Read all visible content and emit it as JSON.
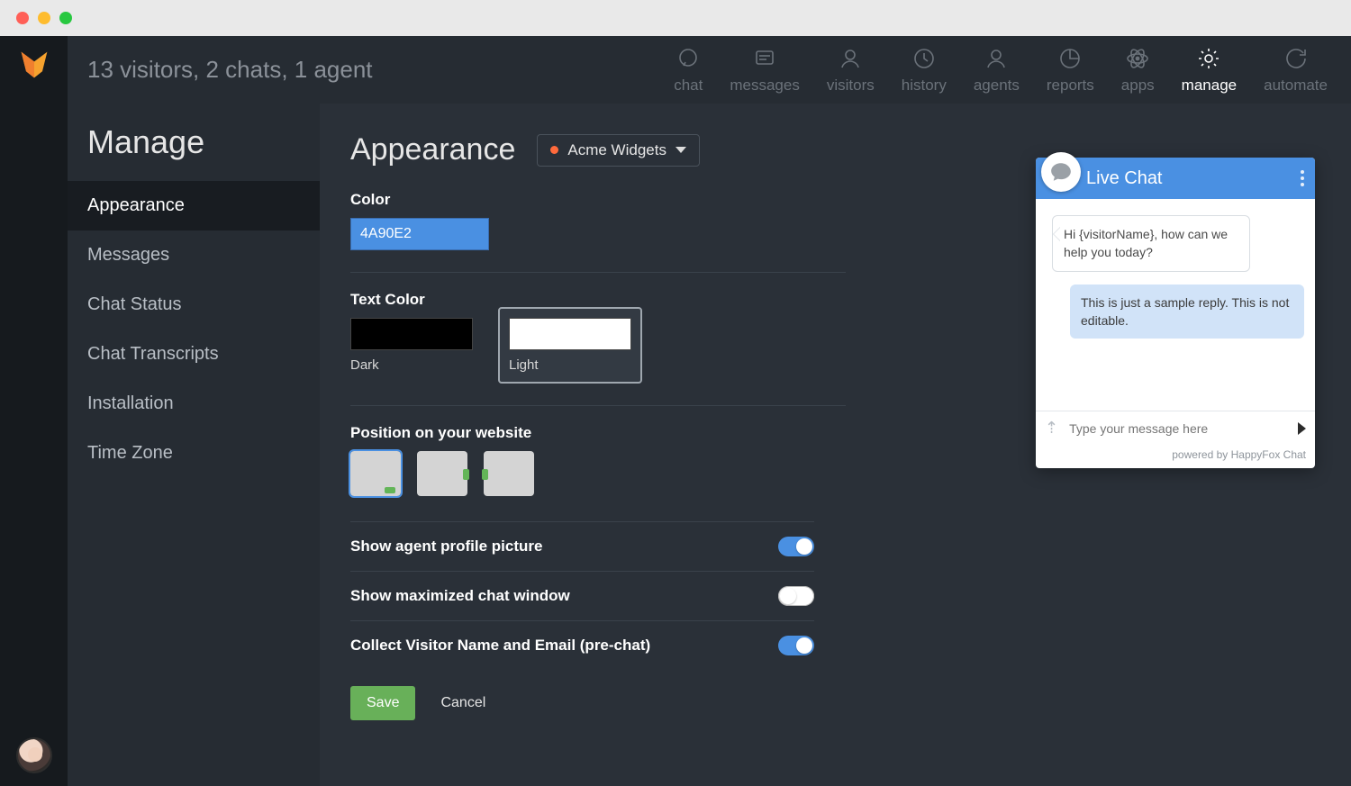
{
  "header": {
    "stats": "13 visitors, 2 chats, 1 agent"
  },
  "topnav": [
    {
      "key": "chat",
      "label": "chat",
      "icon": "chat-bubble-icon",
      "active": false
    },
    {
      "key": "messages",
      "label": "messages",
      "icon": "messages-icon",
      "active": false
    },
    {
      "key": "visitors",
      "label": "visitors",
      "icon": "person-icon",
      "active": false
    },
    {
      "key": "history",
      "label": "history",
      "icon": "clock-icon",
      "active": false
    },
    {
      "key": "agents",
      "label": "agents",
      "icon": "person-icon",
      "active": false
    },
    {
      "key": "reports",
      "label": "reports",
      "icon": "pie-chart-icon",
      "active": false
    },
    {
      "key": "apps",
      "label": "apps",
      "icon": "atom-icon",
      "active": false
    },
    {
      "key": "manage",
      "label": "manage",
      "icon": "gear-icon",
      "active": true
    },
    {
      "key": "automate",
      "label": "automate",
      "icon": "refresh-icon",
      "active": false
    }
  ],
  "sidebar": {
    "title": "Manage",
    "items": [
      {
        "label": "Appearance",
        "active": true
      },
      {
        "label": "Messages",
        "active": false
      },
      {
        "label": "Chat Status",
        "active": false
      },
      {
        "label": "Chat Transcripts",
        "active": false
      },
      {
        "label": "Installation",
        "active": false
      },
      {
        "label": "Time Zone",
        "active": false
      }
    ]
  },
  "page": {
    "title": "Appearance",
    "site_selector": {
      "label": "Acme Widgets"
    },
    "sections": {
      "color": {
        "label": "Color",
        "value": "4A90E2"
      },
      "text_color": {
        "label": "Text Color",
        "options": [
          {
            "label": "Dark",
            "value": "dark"
          },
          {
            "label": "Light",
            "value": "light"
          }
        ],
        "selected": "light"
      },
      "position": {
        "label": "Position on your website",
        "options": [
          "bottom-right",
          "right",
          "left"
        ],
        "selected": "bottom-right"
      },
      "toggles": [
        {
          "label": "Show agent profile picture",
          "on": true
        },
        {
          "label": "Show maximized chat window",
          "on": false
        },
        {
          "label": "Collect Visitor Name and Email (pre-chat)",
          "on": true
        }
      ]
    },
    "actions": {
      "save": "Save",
      "cancel": "Cancel"
    }
  },
  "chat_preview": {
    "title": "Live Chat",
    "greeting": "Hi {visitorName}, how can we help you today?",
    "sample_reply": "This is just a sample reply. This is not editable.",
    "input_placeholder": "Type your message here",
    "footer": "powered by HappyFox Chat"
  },
  "colors": {
    "accent": "#4A90E2",
    "save_btn": "#68b059"
  }
}
